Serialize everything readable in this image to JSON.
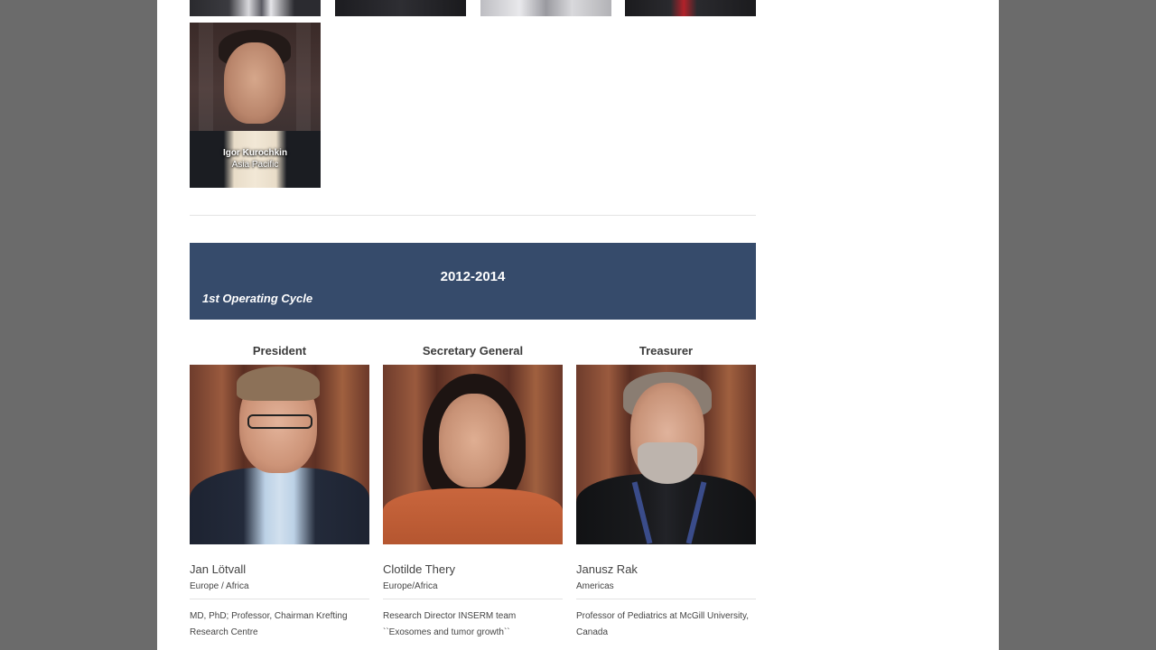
{
  "previous_members": [
    {
      "name": "Igor Kurochkin",
      "region": "Asia Pacific"
    }
  ],
  "cycle": {
    "years": "2012-2014",
    "label": "1st Operating Cycle"
  },
  "officers": [
    {
      "role": "President",
      "name": "Jan Lötvall",
      "region": "Europe / Africa",
      "description": "MD, PhD; Professor, Chairman Krefting Research Centre"
    },
    {
      "role": "Secretary General",
      "name": "Clotilde Thery",
      "region": "Europe/Africa",
      "description": "Research Director INSERM team ``Exosomes and tumor growth``"
    },
    {
      "role": "Treasurer",
      "name": "Janusz Rak",
      "region": "Americas",
      "description": "Professor of Pediatrics at McGill University, Canada"
    }
  ],
  "colors": {
    "banner": "#364b6b",
    "backdrop": "#6b6b6b",
    "page": "#ffffff"
  }
}
